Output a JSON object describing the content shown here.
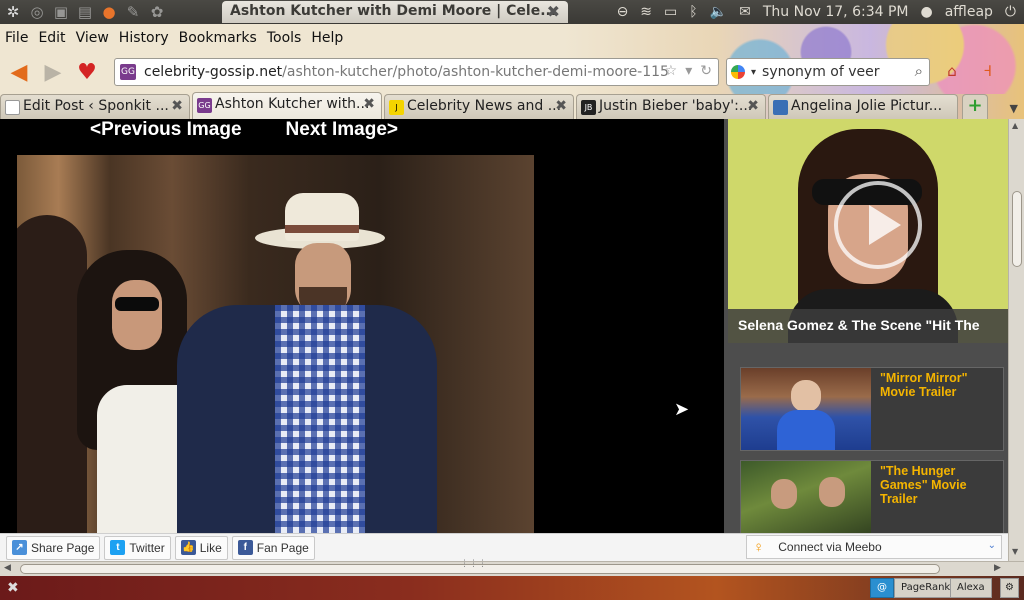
{
  "top_panel": {
    "window_title": "Ashton Kutcher with Demi Moore | Cele...",
    "clock": "Thu Nov 17,  6:34 PM",
    "user": "affleap"
  },
  "menubar": {
    "items": [
      {
        "label": "File"
      },
      {
        "label": "Edit"
      },
      {
        "label": "View"
      },
      {
        "label": "History"
      },
      {
        "label": "Bookmarks"
      },
      {
        "label": "Tools"
      },
      {
        "label": "Help"
      }
    ]
  },
  "navbar": {
    "favicon_text": "GG",
    "url_domain": "celebrity-gossip.net",
    "url_path": "/ashton-kutcher/photo/ashton-kutcher-demi-moore-115",
    "search_value": "synonym of veer"
  },
  "tabs": [
    {
      "label": "Edit Post ‹ Sponkit ...",
      "favicon": "",
      "color": "#ffffff",
      "active": false
    },
    {
      "label": "Ashton Kutcher with...",
      "favicon": "GG",
      "color": "#7a3b8d",
      "active": true
    },
    {
      "label": "Celebrity News and ...",
      "favicon": "J",
      "color": "#1a1a1a",
      "active": false
    },
    {
      "label": "Justin Bieber 'baby':...",
      "favicon": "JB",
      "color": "#222222",
      "active": false
    },
    {
      "label": "Angelina Jolie Pictur...",
      "favicon": "",
      "color": "#3a6fb5",
      "active": false
    }
  ],
  "page": {
    "prev_label": "<Previous Image",
    "next_label": "Next Image>",
    "video_caption": "Selena Gomez & The Scene \"Hit The",
    "related": [
      {
        "title": "\"Mirror Mirror\" Movie Trailer"
      },
      {
        "title": "\"The Hunger Games\" Movie Trailer"
      }
    ]
  },
  "share_bar": {
    "share": "Share Page",
    "twitter": "Twitter",
    "like": "Like",
    "fan_page": "Fan Page",
    "meebo": "Connect via Meebo"
  },
  "status_bar": {
    "pagerank": "PageRank",
    "alexa": "Alexa"
  }
}
